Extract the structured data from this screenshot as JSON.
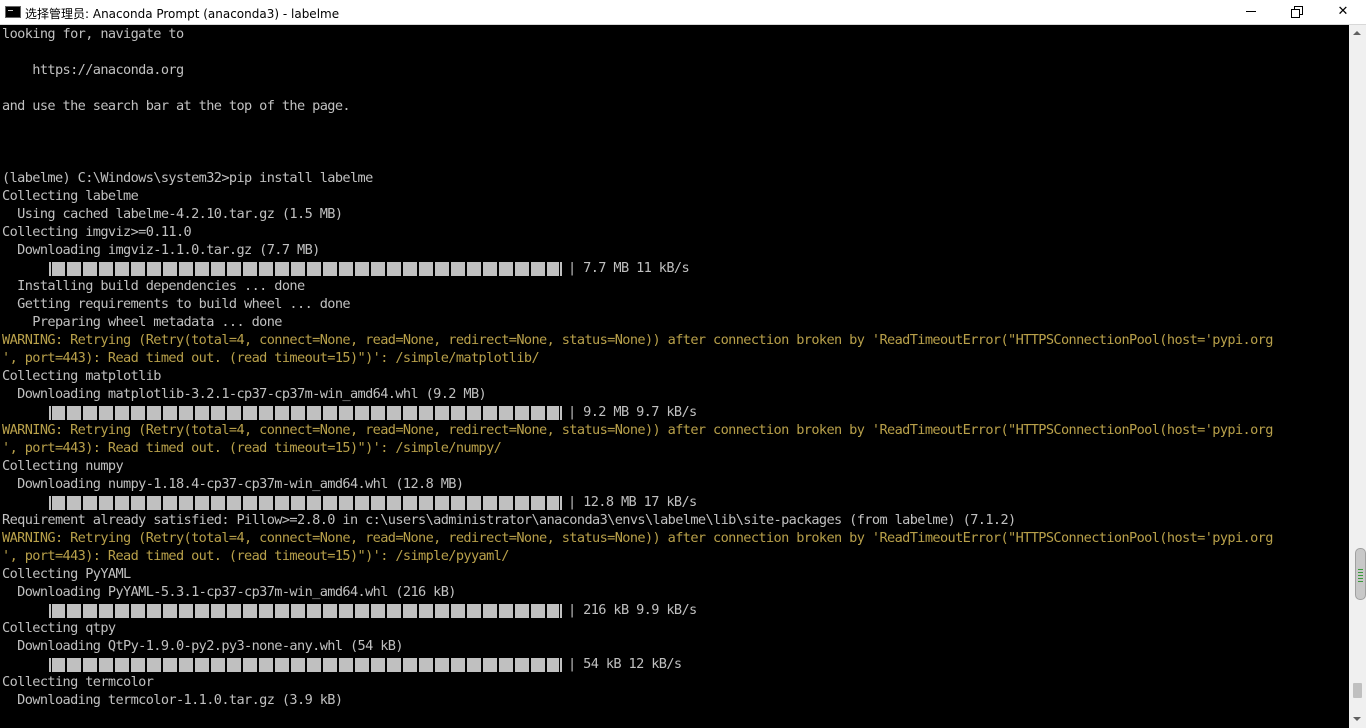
{
  "window": {
    "title": "选择管理员: Anaconda Prompt (anaconda3) - labelme",
    "icon": "console-icon",
    "controls": {
      "minimize_icon": "minimize-icon",
      "maximize_icon": "restore-icon",
      "close_label": "✕"
    }
  },
  "colors": {
    "background": "#000000",
    "text": "#c0c0c0",
    "warning": "#b8a04a"
  },
  "console": {
    "lines": [
      {
        "type": "text",
        "text": "looking for, navigate to"
      },
      {
        "type": "text",
        "text": ""
      },
      {
        "type": "text",
        "text": "    https://anaconda.org"
      },
      {
        "type": "text",
        "text": ""
      },
      {
        "type": "text",
        "text": "and use the search bar at the top of the page."
      },
      {
        "type": "text",
        "text": ""
      },
      {
        "type": "text",
        "text": ""
      },
      {
        "type": "text",
        "text": ""
      },
      {
        "type": "text",
        "text": "(labelme) C:\\Windows\\system32>pip install labelme"
      },
      {
        "type": "text",
        "text": "Collecting labelme"
      },
      {
        "type": "text",
        "text": "  Using cached labelme-4.2.10.tar.gz (1.5 MB)"
      },
      {
        "type": "text",
        "text": "Collecting imgviz>=0.11.0"
      },
      {
        "type": "text",
        "text": "  Downloading imgviz-1.1.0.tar.gz (7.7 MB)"
      },
      {
        "type": "progress",
        "text": "| 7.7 MB 11 kB/s",
        "progress": 1.0
      },
      {
        "type": "text",
        "text": "  Installing build dependencies ... done"
      },
      {
        "type": "text",
        "text": "  Getting requirements to build wheel ... done"
      },
      {
        "type": "text",
        "text": "    Preparing wheel metadata ... done"
      },
      {
        "type": "warn",
        "text": "WARNING: Retrying (Retry(total=4, connect=None, read=None, redirect=None, status=None)) after connection broken by 'ReadTimeoutError(\"HTTPSConnectionPool(host='pypi.org"
      },
      {
        "type": "warn",
        "text": "', port=443): Read timed out. (read timeout=15)\")': /simple/matplotlib/"
      },
      {
        "type": "text",
        "text": "Collecting matplotlib"
      },
      {
        "type": "text",
        "text": "  Downloading matplotlib-3.2.1-cp37-cp37m-win_amd64.whl (9.2 MB)"
      },
      {
        "type": "progress",
        "text": "| 9.2 MB 9.7 kB/s",
        "progress": 1.0
      },
      {
        "type": "warn",
        "text": "WARNING: Retrying (Retry(total=4, connect=None, read=None, redirect=None, status=None)) after connection broken by 'ReadTimeoutError(\"HTTPSConnectionPool(host='pypi.org"
      },
      {
        "type": "warn",
        "text": "', port=443): Read timed out. (read timeout=15)\")': /simple/numpy/"
      },
      {
        "type": "text",
        "text": "Collecting numpy"
      },
      {
        "type": "text",
        "text": "  Downloading numpy-1.18.4-cp37-cp37m-win_amd64.whl (12.8 MB)"
      },
      {
        "type": "progress",
        "text": "| 12.8 MB 17 kB/s",
        "progress": 1.0
      },
      {
        "type": "text",
        "text": "Requirement already satisfied: Pillow>=2.8.0 in c:\\users\\administrator\\anaconda3\\envs\\labelme\\lib\\site-packages (from labelme) (7.1.2)"
      },
      {
        "type": "warn",
        "text": "WARNING: Retrying (Retry(total=4, connect=None, read=None, redirect=None, status=None)) after connection broken by 'ReadTimeoutError(\"HTTPSConnectionPool(host='pypi.org"
      },
      {
        "type": "warn",
        "text": "', port=443): Read timed out. (read timeout=15)\")': /simple/pyyaml/"
      },
      {
        "type": "text",
        "text": "Collecting PyYAML"
      },
      {
        "type": "text",
        "text": "  Downloading PyYAML-5.3.1-cp37-cp37m-win_amd64.whl (216 kB)"
      },
      {
        "type": "progress",
        "text": "| 216 kB 9.9 kB/s",
        "progress": 1.0
      },
      {
        "type": "text",
        "text": "Collecting qtpy"
      },
      {
        "type": "text",
        "text": "  Downloading QtPy-1.9.0-py2.py3-none-any.whl (54 kB)"
      },
      {
        "type": "progress",
        "text": "| 54 kB 12 kB/s",
        "progress": 1.0
      },
      {
        "type": "text",
        "text": "Collecting termcolor"
      },
      {
        "type": "text",
        "text": "  Downloading termcolor-1.1.0.tar.gz (3.9 kB)"
      }
    ]
  },
  "scrollbar": {
    "up_icon": "scroll-up-arrow-icon",
    "down_icon": "scroll-down-arrow-icon",
    "position": 0.98
  }
}
